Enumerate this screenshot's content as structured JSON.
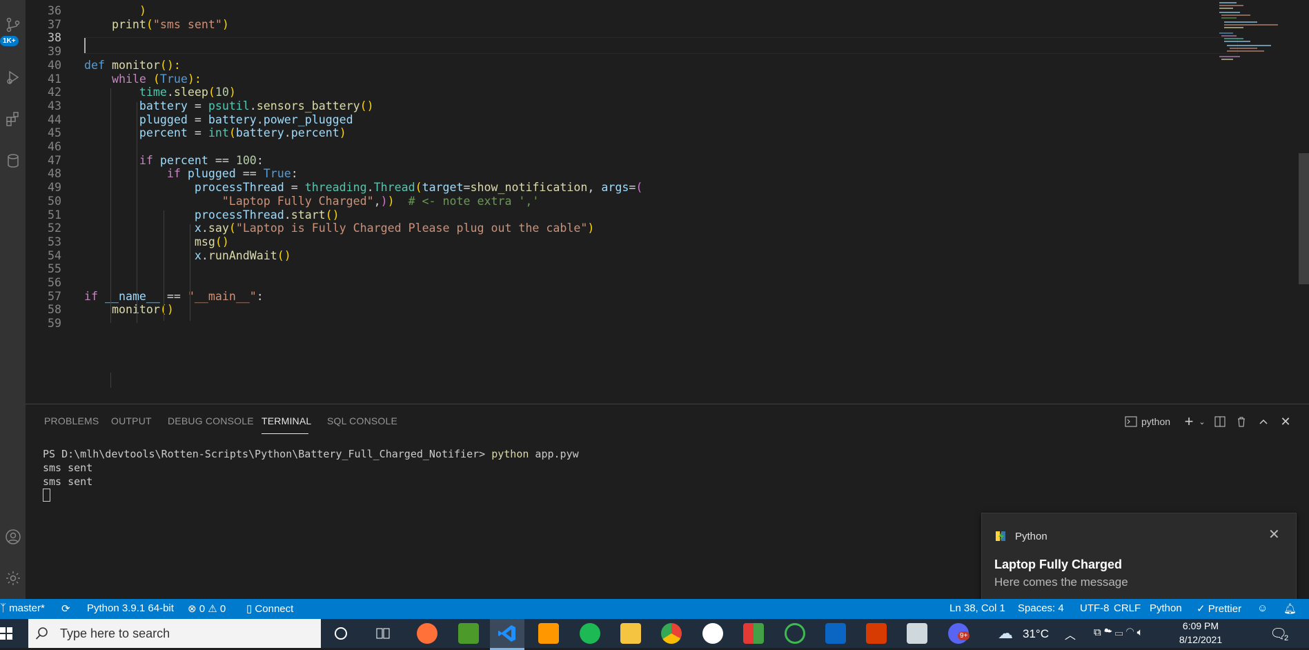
{
  "editor": {
    "lines": [
      {
        "num": "36",
        "tokens": [
          {
            "t": "        ",
            "c": "w"
          },
          {
            "t": ")",
            "c": "b1"
          }
        ]
      },
      {
        "num": "37",
        "tokens": [
          {
            "t": "    print",
            "c": "f"
          },
          {
            "t": "(",
            "c": "b1"
          },
          {
            "t": "\"sms sent\"",
            "c": "s"
          },
          {
            "t": ")",
            "c": "b1"
          }
        ]
      },
      {
        "num": "38",
        "tokens": []
      },
      {
        "num": "39",
        "tokens": []
      },
      {
        "num": "40",
        "tokens": [
          {
            "t": "def ",
            "c": "d"
          },
          {
            "t": "monitor",
            "c": "f"
          },
          {
            "t": "():",
            "c": "b1"
          }
        ]
      },
      {
        "num": "41",
        "tokens": [
          {
            "t": "    while ",
            "c": "k"
          },
          {
            "t": "(",
            "c": "b1"
          },
          {
            "t": "True",
            "c": "d"
          },
          {
            "t": "):",
            "c": "b1"
          }
        ]
      },
      {
        "num": "42",
        "tokens": [
          {
            "t": "        time",
            "c": "t"
          },
          {
            "t": ".",
            "c": "w"
          },
          {
            "t": "sleep",
            "c": "f"
          },
          {
            "t": "(",
            "c": "b1"
          },
          {
            "t": "10",
            "c": "n"
          },
          {
            "t": ")",
            "c": "b1"
          }
        ]
      },
      {
        "num": "43",
        "tokens": [
          {
            "t": "        battery ",
            "c": "v"
          },
          {
            "t": "= ",
            "c": "w"
          },
          {
            "t": "psutil",
            "c": "t"
          },
          {
            "t": ".",
            "c": "w"
          },
          {
            "t": "sensors_battery",
            "c": "f"
          },
          {
            "t": "()",
            "c": "b1"
          }
        ]
      },
      {
        "num": "44",
        "tokens": [
          {
            "t": "        plugged ",
            "c": "v"
          },
          {
            "t": "= ",
            "c": "w"
          },
          {
            "t": "battery",
            "c": "v"
          },
          {
            "t": ".",
            "c": "w"
          },
          {
            "t": "power_plugged",
            "c": "v"
          }
        ]
      },
      {
        "num": "45",
        "tokens": [
          {
            "t": "        percent ",
            "c": "v"
          },
          {
            "t": "= ",
            "c": "w"
          },
          {
            "t": "int",
            "c": "t"
          },
          {
            "t": "(",
            "c": "b1"
          },
          {
            "t": "battery",
            "c": "v"
          },
          {
            "t": ".",
            "c": "w"
          },
          {
            "t": "percent",
            "c": "v"
          },
          {
            "t": ")",
            "c": "b1"
          }
        ]
      },
      {
        "num": "46",
        "tokens": []
      },
      {
        "num": "47",
        "tokens": [
          {
            "t": "        if ",
            "c": "k"
          },
          {
            "t": "percent ",
            "c": "v"
          },
          {
            "t": "== ",
            "c": "w"
          },
          {
            "t": "100",
            "c": "n"
          },
          {
            "t": ":",
            "c": "w"
          }
        ]
      },
      {
        "num": "48",
        "tokens": [
          {
            "t": "            if ",
            "c": "k"
          },
          {
            "t": "plugged ",
            "c": "v"
          },
          {
            "t": "== ",
            "c": "w"
          },
          {
            "t": "True",
            "c": "d"
          },
          {
            "t": ":",
            "c": "w"
          }
        ]
      },
      {
        "num": "49",
        "tokens": [
          {
            "t": "                processThread ",
            "c": "v"
          },
          {
            "t": "= ",
            "c": "w"
          },
          {
            "t": "threading",
            "c": "t"
          },
          {
            "t": ".",
            "c": "w"
          },
          {
            "t": "Thread",
            "c": "t"
          },
          {
            "t": "(",
            "c": "b1"
          },
          {
            "t": "target",
            "c": "v"
          },
          {
            "t": "=",
            "c": "w"
          },
          {
            "t": "show_notification",
            "c": "f"
          },
          {
            "t": ", ",
            "c": "w"
          },
          {
            "t": "args",
            "c": "v"
          },
          {
            "t": "=",
            "c": "w"
          },
          {
            "t": "(",
            "c": "b2"
          }
        ]
      },
      {
        "num": "50",
        "tokens": [
          {
            "t": "                    \"Laptop Fully Charged\"",
            "c": "s"
          },
          {
            "t": ",",
            "c": "w"
          },
          {
            "t": ")",
            "c": "b2"
          },
          {
            "t": ")",
            "c": "b1"
          },
          {
            "t": "  # <- note extra ','",
            "c": "c"
          }
        ]
      },
      {
        "num": "51",
        "tokens": [
          {
            "t": "                processThread",
            "c": "v"
          },
          {
            "t": ".",
            "c": "w"
          },
          {
            "t": "start",
            "c": "f"
          },
          {
            "t": "()",
            "c": "b1"
          }
        ]
      },
      {
        "num": "52",
        "tokens": [
          {
            "t": "                x",
            "c": "v"
          },
          {
            "t": ".",
            "c": "w"
          },
          {
            "t": "say",
            "c": "f"
          },
          {
            "t": "(",
            "c": "b1"
          },
          {
            "t": "\"Laptop is Fully Charged Please plug out the cable\"",
            "c": "s"
          },
          {
            "t": ")",
            "c": "b1"
          }
        ]
      },
      {
        "num": "53",
        "tokens": [
          {
            "t": "                msg",
            "c": "f"
          },
          {
            "t": "()",
            "c": "b1"
          }
        ]
      },
      {
        "num": "54",
        "tokens": [
          {
            "t": "                x",
            "c": "v"
          },
          {
            "t": ".",
            "c": "w"
          },
          {
            "t": "runAndWait",
            "c": "f"
          },
          {
            "t": "()",
            "c": "b1"
          }
        ]
      },
      {
        "num": "55",
        "tokens": []
      },
      {
        "num": "56",
        "tokens": []
      },
      {
        "num": "57",
        "tokens": [
          {
            "t": "if ",
            "c": "k"
          },
          {
            "t": "__name__ ",
            "c": "v"
          },
          {
            "t": "== ",
            "c": "w"
          },
          {
            "t": "\"__main__\"",
            "c": "s"
          },
          {
            "t": ":",
            "c": "w"
          }
        ]
      },
      {
        "num": "58",
        "tokens": [
          {
            "t": "    monitor",
            "c": "f"
          },
          {
            "t": "()",
            "c": "b1"
          }
        ]
      },
      {
        "num": "59",
        "tokens": []
      }
    ],
    "active_line": "38"
  },
  "activity_bar": {
    "badge": "1K+",
    "icons": [
      "source-control-icon",
      "run-debug-icon",
      "extensions-icon",
      "database-icon",
      "accounts-icon",
      "settings-gear-icon"
    ]
  },
  "panel": {
    "tabs": [
      "PROBLEMS",
      "OUTPUT",
      "DEBUG CONSOLE",
      "TERMINAL",
      "SQL CONSOLE"
    ],
    "active_tab": "TERMINAL",
    "terminal_name": "python",
    "terminal": {
      "prompt": "PS D:\\mlh\\devtools\\Rotten-Scripts\\Python\\Battery_Full_Charged_Notifier> ",
      "command": "python",
      "args": " app.pyw",
      "output": [
        "sms sent",
        "sms sent"
      ]
    }
  },
  "statusbar": {
    "branch": "master*",
    "interpreter": "Python 3.9.1 64-bit",
    "errors": "0",
    "warnings": "0",
    "connect": "Connect",
    "position": "Ln 38, Col 1",
    "spaces": "Spaces: 4",
    "encoding": "UTF-8",
    "eol": "CRLF",
    "language": "Python",
    "formatter": "Prettier"
  },
  "notification": {
    "app": "Python",
    "title": "Laptop Fully Charged",
    "message": "Here comes the message"
  },
  "taskbar": {
    "search_placeholder": "Type here to search",
    "weather": "31°C",
    "time": "6:09 PM",
    "date": "8/12/2021",
    "notification_count": "2",
    "discord_badge": "9+",
    "colors": {
      "vscode": "#1e90ff",
      "spotify": "#1db954",
      "sublime": "#ff9800",
      "office": "#d83b01",
      "linkedin": "#0a66c2"
    }
  }
}
